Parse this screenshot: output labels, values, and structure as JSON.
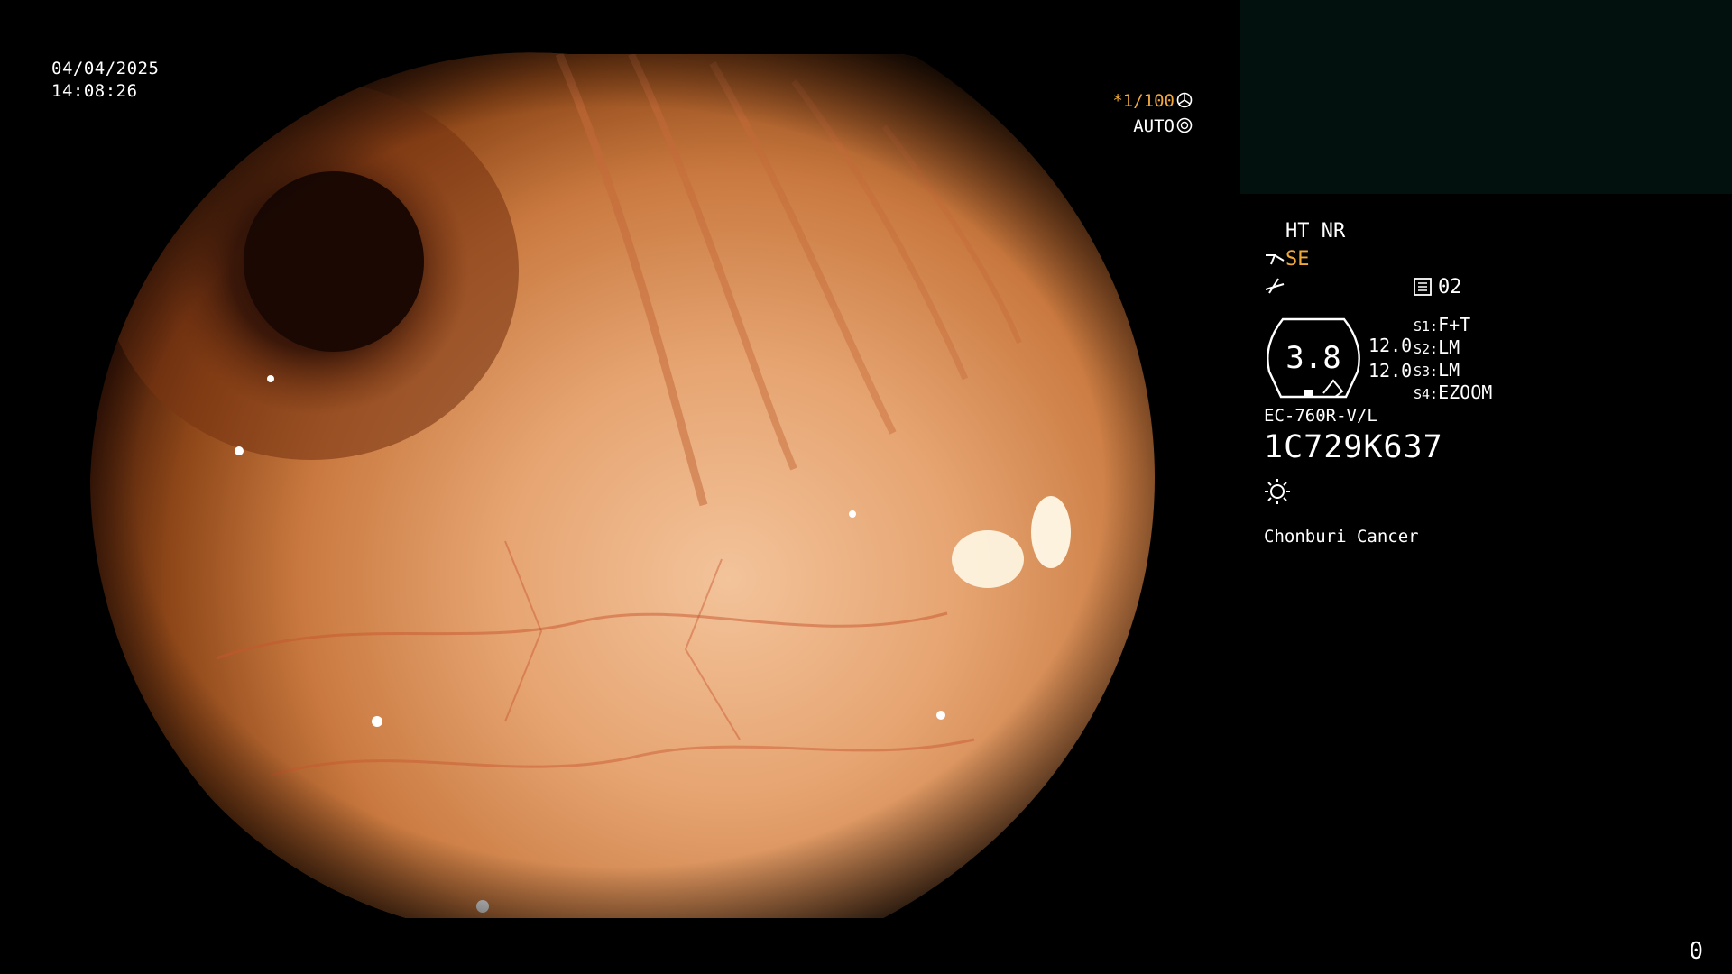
{
  "overlay": {
    "date": "04/04/2025",
    "time": "14:08:26",
    "shutter": "*1/100",
    "auto_label": "AUTO",
    "page_number": "0"
  },
  "panel": {
    "mode_line": "HT NR",
    "enhance_label": "SE",
    "memory_value": "02",
    "gauge_value": "3.8",
    "gain_top": "12.0",
    "gain_bottom": "12.0",
    "scenes": [
      {
        "key": "S1:",
        "value": "F+T"
      },
      {
        "key": "S2:",
        "value": "LM"
      },
      {
        "key": "S3:",
        "value": "LM"
      },
      {
        "key": "S4:",
        "value": "EZOOM"
      }
    ],
    "scope_model": "EC-760R-V/L",
    "serial_number": "1C729K637",
    "hospital": "Chonburi Cancer"
  },
  "colors": {
    "accent_amber": "#f0a83c",
    "panel_box": "#02110e"
  },
  "icons": [
    "shutter-aperture-icon",
    "auto-iris-icon",
    "scope-tip-icon",
    "waveform-icon",
    "memory-icon",
    "light-source-icon"
  ]
}
